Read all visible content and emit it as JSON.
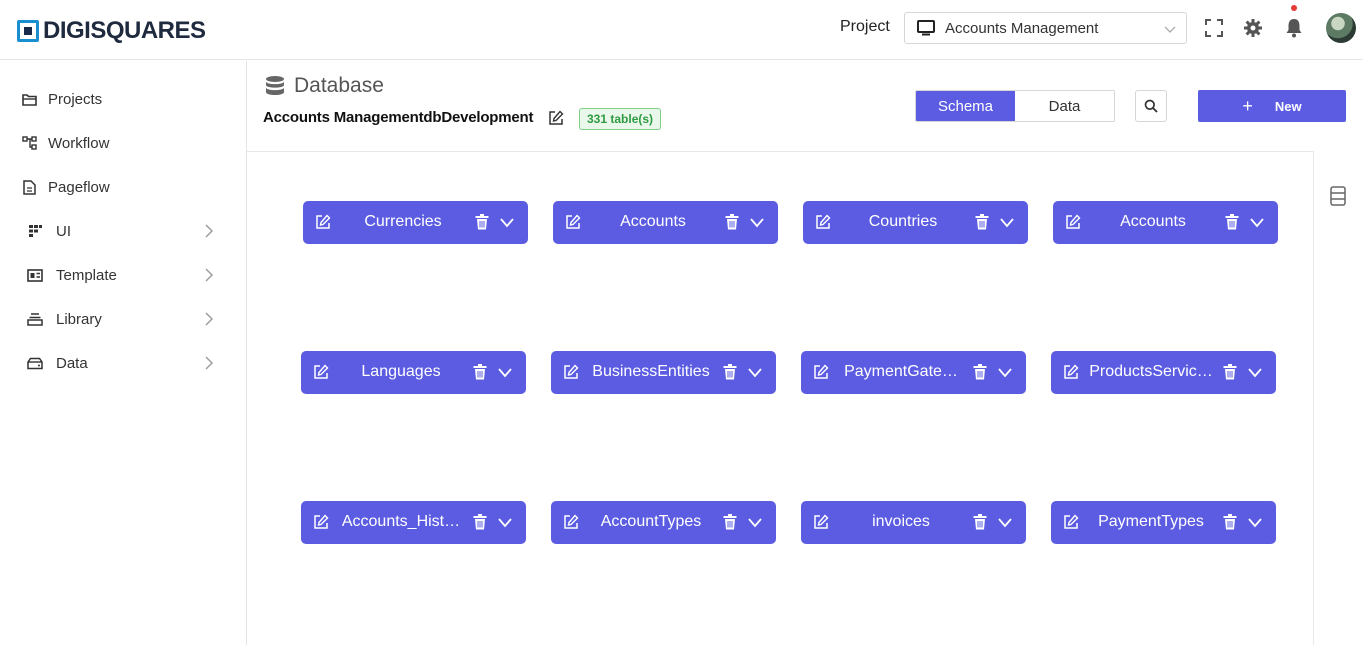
{
  "header": {
    "logo_text": "DIGISQUARES",
    "project_label": "Project",
    "project_value": "Accounts Management"
  },
  "sidebar": {
    "items": [
      {
        "label": "Projects",
        "icon": "folder-icon",
        "expandable": false
      },
      {
        "label": "Workflow",
        "icon": "workflow-icon",
        "expandable": false
      },
      {
        "label": "Pageflow",
        "icon": "pageflow-icon",
        "expandable": false
      },
      {
        "label": "UI",
        "icon": "ui-grid-icon",
        "expandable": true
      },
      {
        "label": "Template",
        "icon": "template-icon",
        "expandable": true
      },
      {
        "label": "Library",
        "icon": "library-icon",
        "expandable": true
      },
      {
        "label": "Data",
        "icon": "data-icon",
        "expandable": true
      }
    ]
  },
  "main": {
    "title": "Database",
    "db_name": "Accounts ManagementdbDevelopment",
    "table_count": "331 table(s)",
    "tabs": [
      {
        "label": "Schema",
        "active": true
      },
      {
        "label": "Data",
        "active": false
      }
    ],
    "new_label": "New",
    "new_plus": "+"
  },
  "tables": [
    {
      "name": "Currencies"
    },
    {
      "name": "Accounts"
    },
    {
      "name": "Countries"
    },
    {
      "name": "Accounts"
    },
    {
      "name": "Languages"
    },
    {
      "name": "BusinessEntities"
    },
    {
      "name": "PaymentGate…"
    },
    {
      "name": "ProductsServic…"
    },
    {
      "name": "Accounts_Hist…"
    },
    {
      "name": "AccountTypes"
    },
    {
      "name": "invoices"
    },
    {
      "name": "PaymentTypes"
    }
  ],
  "colors": {
    "accent": "#5b5ce2",
    "badge_green": "#2e9b41"
  }
}
